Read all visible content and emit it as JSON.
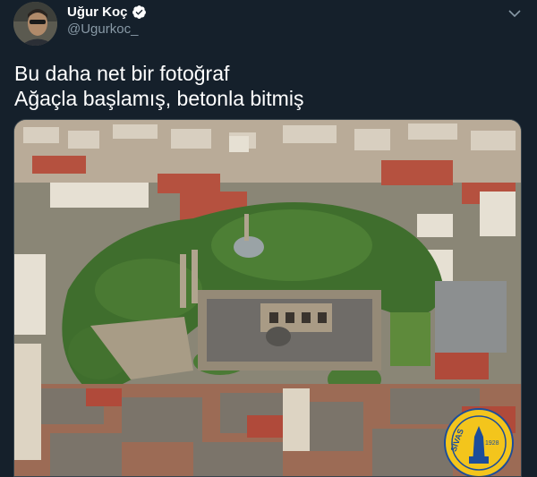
{
  "user": {
    "display_name": "Uğur Koç",
    "handle": "@Ugurkoc_",
    "verified": true
  },
  "tweet": {
    "line1": "Bu daha net bir fotoğraf",
    "line2": "Ağaçla başlamış, betonla bitmiş"
  },
  "photo": {
    "subject": "aerial-city-photo",
    "seal_text": "SİVAS",
    "seal_year": "1928"
  },
  "icons": {
    "verified": "verified-badge-icon",
    "menu": "chevron-down-icon"
  },
  "colors": {
    "background": "#15202b",
    "secondary_text": "#8899a6",
    "verified_badge": "#ffffff"
  }
}
